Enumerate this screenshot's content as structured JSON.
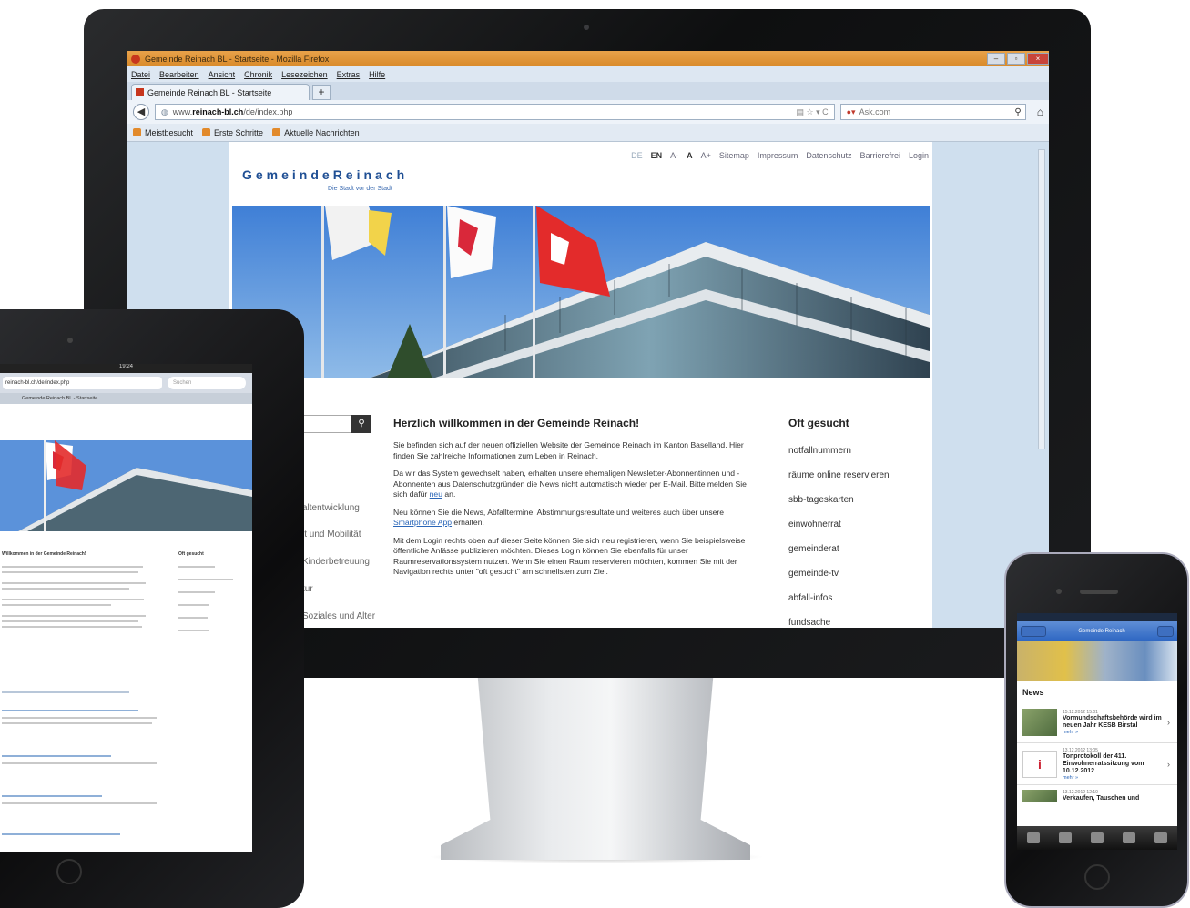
{
  "browser": {
    "window_title": "Gemeinde Reinach BL - Startseite - Mozilla Firefox",
    "menu": [
      "Datei",
      "Bearbeiten",
      "Ansicht",
      "Chronik",
      "Lesezeichen",
      "Extras",
      "Hilfe"
    ],
    "tab_label": "Gemeinde Reinach BL - Startseite",
    "url_prefix": "www.",
    "url_domain": "reinach-bl.ch",
    "url_path": "/de/index.php",
    "search_placeholder": "Ask.com",
    "bookmarks": [
      "Meistbesucht",
      "Erste Schritte",
      "Aktuelle Nachrichten"
    ]
  },
  "site": {
    "toplinks": [
      "DE",
      "EN",
      "A-",
      "A",
      "A+",
      "Sitemap",
      "Impressum",
      "Datenschutz",
      "Barrierefrei",
      "Login"
    ],
    "logo_text": "GemeindeReinach",
    "logo_sub": "Die Stadt vor der Stadt",
    "nav_items": [
      "altentwicklung",
      "it und Mobilität",
      "Kinderbetreuung",
      "tur",
      "Soziales und Alter"
    ],
    "heading": "Herzlich willkommen in der Gemeinde Reinach!",
    "paragraphs": [
      "Sie befinden sich auf der neuen offiziellen Website der Gemeinde Reinach im Kanton Baselland. Hier finden Sie zahlreiche Informationen zum Leben in Reinach.",
      "Da wir das System gewechselt haben, erhalten unsere ehemaligen Newsletter-Abonnentinnen und -Abonnenten aus Datenschutzgründen die News nicht automatisch wieder per E-Mail. Bitte melden Sie sich dafür",
      "Neu können Sie die News, Abfalltermine, Abstimmungsresultate und weiteres auch über unsere",
      "Mit dem Login rechts oben auf dieser Seite können Sie sich neu registrieren, wenn Sie beispielsweise öffentliche Anlässe publizieren möchten. Dieses Login können Sie ebenfalls für unser Raumreservationssystem nutzen. Wenn Sie einen Raum reservieren möchten, kommen Sie mit der Navigation rechts unter \"oft gesucht\" am schnellsten zum Ziel."
    ],
    "link_newsletter": "neu",
    "suffix_newsletter": "an.",
    "link_app": "Smartphone App",
    "suffix_app": "erhalten.",
    "sidebar_title": "Oft gesucht",
    "sidebar_links": [
      "notfallnummern",
      "räume online reservieren",
      "sbb-tageskarten",
      "einwohnerrat",
      "gemeinderat",
      "gemeinde-tv",
      "abfall-infos",
      "fundsache"
    ]
  },
  "ipad": {
    "status_time": "19:24",
    "url": "reinach-bl.ch/de/index.php",
    "search_placeholder": "Suchen",
    "tab_label": "Gemeinde Reinach BL - Startseite",
    "heading": "Willkommen in der Gemeinde Reinach!",
    "sidebar_title": "Oft gesucht"
  },
  "iphone": {
    "nav_title": "Gemeinde Reinach",
    "section_title": "News",
    "items": [
      {
        "date": "15.12.2012 15:01",
        "headline": "Vormundschaftsbehörde wird im neuen Jahr KESB Birstal",
        "more": "mehr »"
      },
      {
        "date": "13.12.2012 13:05",
        "headline": "Tonprotokoll der 411. Einwohnerratssitzung vom 10.12.2012",
        "more": "mehr »"
      },
      {
        "date": "13.12.2012 12:10",
        "headline": "Verkaufen, Tauschen und",
        "more": ""
      }
    ]
  },
  "colors": {
    "brand_blue": "#1f4f94",
    "link_blue": "#2a66b8",
    "firefox_orange": "#e8a24a"
  }
}
